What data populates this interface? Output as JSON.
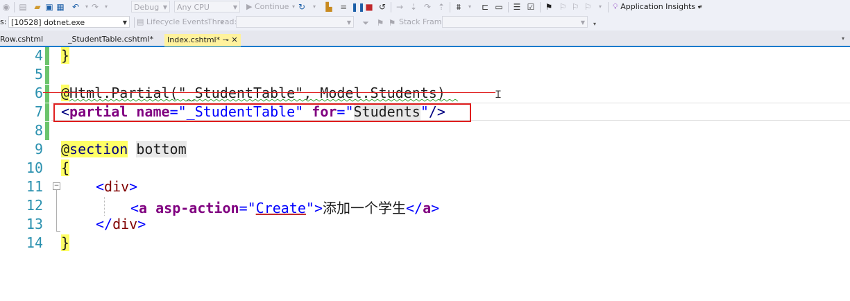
{
  "toolbar": {
    "debug_config": "Debug",
    "platform": "Any CPU",
    "continue_label": "Continue",
    "app_insights_label": "Application Insights"
  },
  "debug_bar": {
    "process_prefix": "s:",
    "process_value": "[10528] dotnet.exe",
    "lifecycle_label": "Lifecycle Events",
    "thread_label": "Thread:",
    "stack_frame_label": "Stack Frame:"
  },
  "tabs": [
    {
      "label": "Row.cshtml",
      "active": false
    },
    {
      "label": "_StudentTable.cshtml*",
      "active": false
    },
    {
      "label": "Index.cshtml*",
      "active": true
    }
  ],
  "tab_pin_icon": "pin-icon",
  "tab_close_icon": "close-icon",
  "editor": {
    "line_numbers": [
      "4",
      "5",
      "6",
      "7",
      "8",
      "9",
      "10",
      "11",
      "12",
      "13",
      "14"
    ],
    "lines": {
      "l4": "}",
      "l6_at": "@",
      "l6_text": "Html.Partial(\"_StudentTable\", Model.Students)",
      "l7_open": "<",
      "l7_tag": "partial",
      "l7_sp1": " ",
      "l7_attr1": "name",
      "l7_eq1": "=",
      "l7_q1": "\"",
      "l7_val1": "_StudentTable",
      "l7_q2": "\"",
      "l7_sp2": " ",
      "l7_attr2": "for",
      "l7_eq2": "=",
      "l7_q3": "\"",
      "l7_val2": "Students",
      "l7_q4": "\"",
      "l7_close": "/>",
      "l9_at": "@",
      "l9_kw": "section",
      "l9_sp": " ",
      "l9_name": "bottom",
      "l10": "{",
      "l11_lt": "<",
      "l11_tag": "div",
      "l11_gt": ">",
      "l12_lt": "<",
      "l12_tag": "a",
      "l12_sp": " ",
      "l12_attr": "asp-action",
      "l12_eq": "=",
      "l12_q1": "\"",
      "l12_val": "Create",
      "l12_q2": "\"",
      "l12_gt": ">",
      "l12_text": "添加一个学生",
      "l12_end_lt": "</",
      "l12_end_tag": "a",
      "l12_end_gt": ">",
      "l13_lt": "</",
      "l13_tag": "div",
      "l13_gt": ">",
      "l14": "}"
    }
  },
  "colors": {
    "change_bar": "#6cc46c",
    "highlight_box": "#e01e1e",
    "accent": "#007acc"
  }
}
